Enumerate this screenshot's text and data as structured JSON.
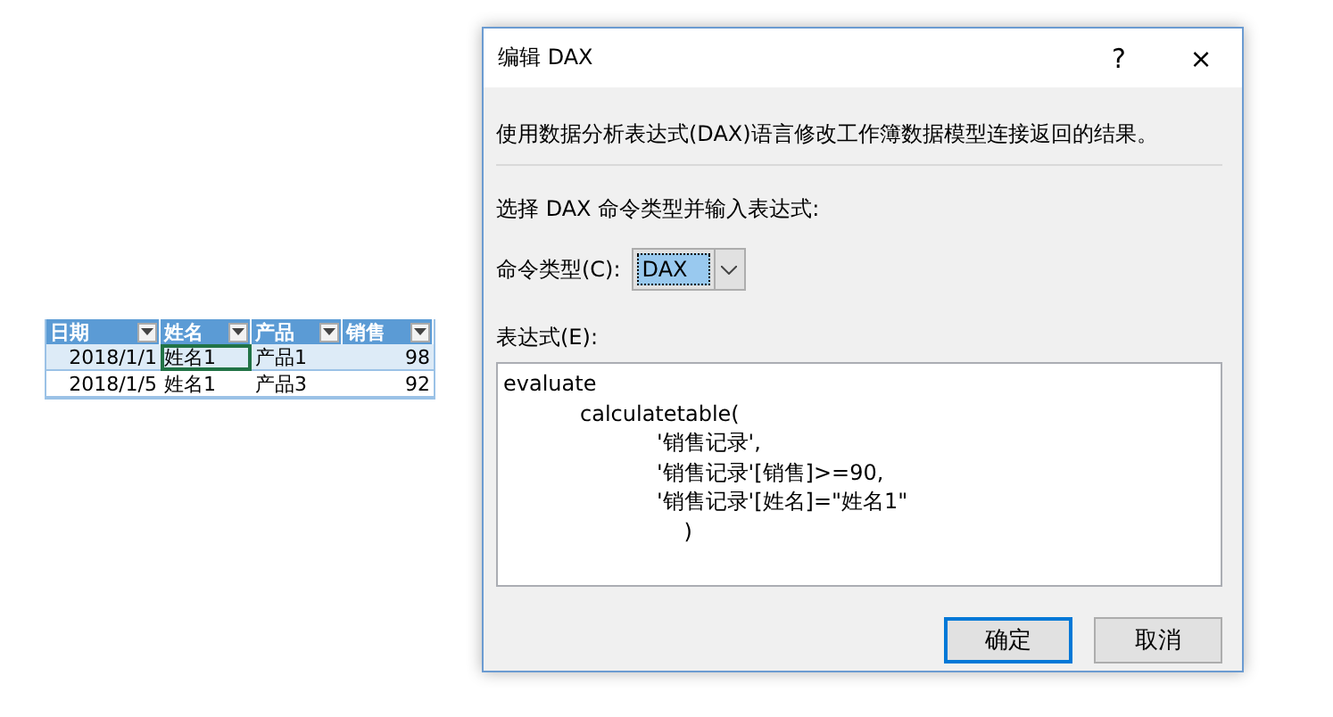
{
  "sheet": {
    "columns": [
      "日期",
      "姓名",
      "产品",
      "销售"
    ],
    "rows": [
      {
        "cells": [
          "2018/1/1",
          "姓名1",
          "产品1",
          "98"
        ],
        "selected": true
      },
      {
        "cells": [
          "2018/1/5",
          "姓名1",
          "产品3",
          "92"
        ],
        "selected": false
      }
    ]
  },
  "dialog": {
    "title": "编辑 DAX",
    "help": "?",
    "close": "×",
    "description": "使用数据分析表达式(DAX)语言修改工作簿数据模型连接返回的结果。",
    "instruction": "选择 DAX 命令类型并输入表达式:",
    "command_type": {
      "label": "命令类型(C):",
      "value": "DAX"
    },
    "expression": {
      "label": "表达式(E):",
      "value": "evaluate\n\tcalculatetable(\n\t\t'销售记录',\n\t\t'销售记录'[销售]>=90,\n\t\t'销售记录'[姓名]=\"姓名1\"\n\t\t    )"
    },
    "buttons": [
      {
        "label": "确定",
        "default": true
      },
      {
        "label": "取消",
        "default": false
      }
    ]
  }
}
